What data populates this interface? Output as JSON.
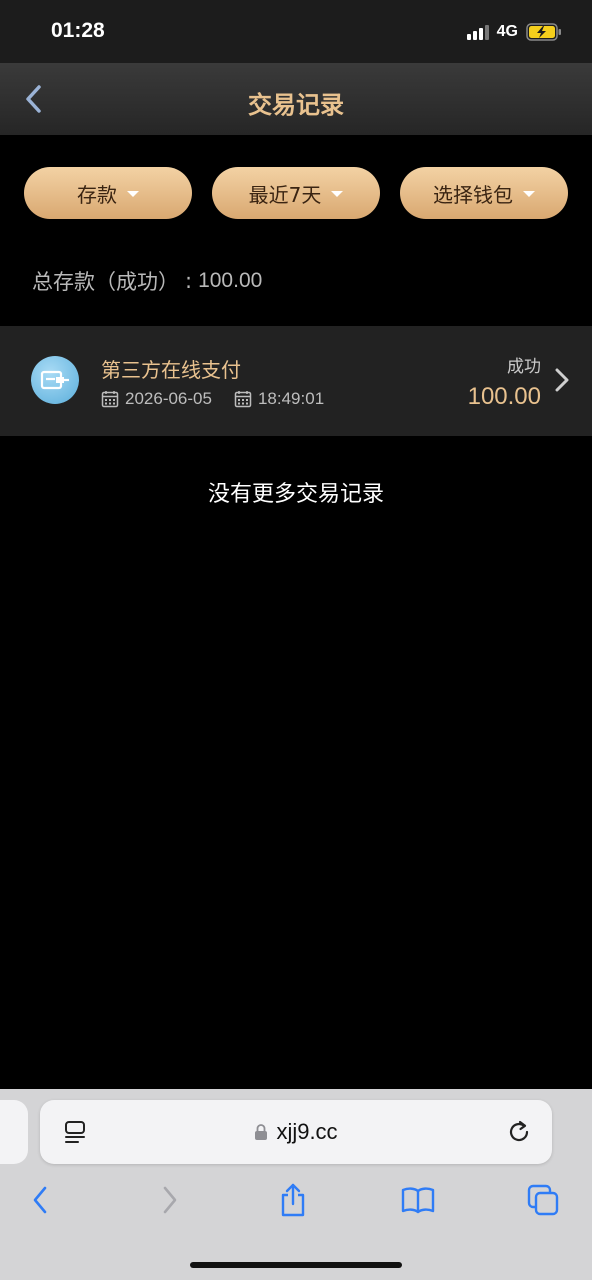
{
  "status_bar": {
    "time": "01:28",
    "network": "4G"
  },
  "header": {
    "title": "交易记录"
  },
  "filters": [
    {
      "label": "存款"
    },
    {
      "label": "最近7天"
    },
    {
      "label": "选择钱包"
    }
  ],
  "summary": {
    "label": "总存款（成功）",
    "separator": ":",
    "value": "100.00"
  },
  "transactions": [
    {
      "method": "第三方在线支付",
      "date": "2026-06-05",
      "time": "18:49:01",
      "status": "成功",
      "amount": "100.00"
    }
  ],
  "empty_message": "没有更多交易记录",
  "browser": {
    "url": "xjj9.cc"
  },
  "colors": {
    "accent_gold": "#e9c28f",
    "button_gold": "#e4b884",
    "background": "#000000",
    "row_bg": "#222222"
  }
}
